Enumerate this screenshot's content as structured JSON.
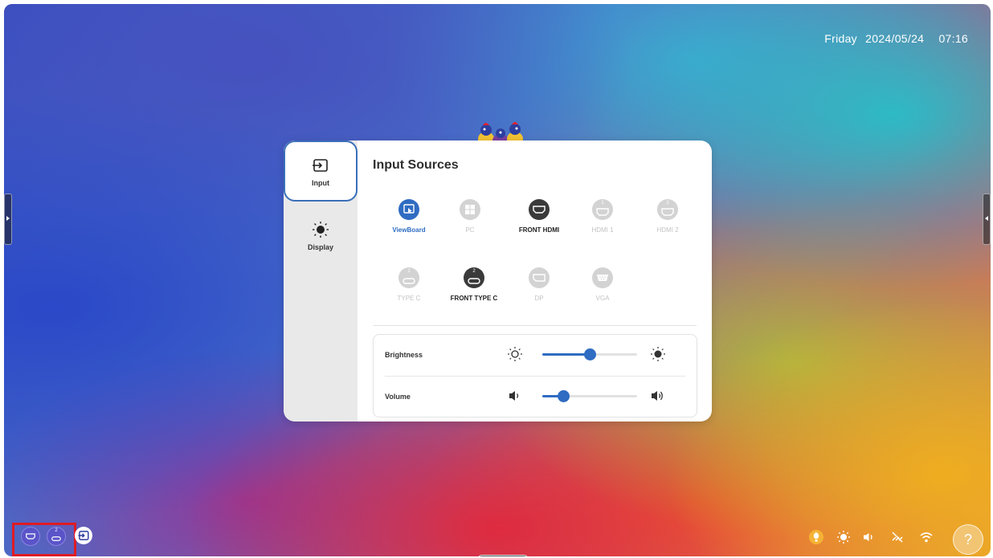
{
  "status_bar": {
    "day": "Friday",
    "date": "2024/05/24",
    "time": "07:16"
  },
  "panel": {
    "title": "Input Sources",
    "tabs": [
      {
        "label": "Input",
        "icon": "input-icon",
        "active": true
      },
      {
        "label": "Display",
        "icon": "brightness-icon",
        "active": false
      }
    ],
    "sources_row1": [
      {
        "label": "ViewBoard",
        "icon": "viewboard-icon",
        "state": "selected"
      },
      {
        "label": "PC",
        "icon": "windows-icon",
        "state": "unavailable"
      },
      {
        "label": "FRONT HDMI",
        "icon": "hdmi-icon",
        "state": "available"
      },
      {
        "label": "HDMI 1",
        "icon": "hdmi-icon",
        "num": "1",
        "state": "unavailable"
      },
      {
        "label": "HDMI 2",
        "icon": "hdmi-icon",
        "num": "2",
        "state": "unavailable"
      }
    ],
    "sources_row2": [
      {
        "label": "TYPE C",
        "icon": "usb-c-icon",
        "num": "1",
        "state": "unavailable"
      },
      {
        "label": "FRONT TYPE C",
        "icon": "usb-c-icon",
        "num": "2",
        "state": "available"
      },
      {
        "label": "DP",
        "icon": "displayport-icon",
        "state": "unavailable"
      },
      {
        "label": "VGA",
        "icon": "vga-icon",
        "state": "unavailable"
      }
    ],
    "controls": {
      "brightness": {
        "label": "Brightness",
        "value_fraction": 0.5
      },
      "volume": {
        "label": "Volume",
        "value_fraction": 0.22
      }
    }
  },
  "taskbar": {
    "left": [
      {
        "icon": "hdmi-icon"
      },
      {
        "icon": "usb-c-icon",
        "num": "2"
      },
      {
        "icon": "input-icon"
      }
    ],
    "tray": [
      "eye-care-icon",
      "brightness-icon",
      "volume-icon",
      "network-disconnected-icon",
      "wifi-icon"
    ],
    "help_label": "?"
  },
  "colors": {
    "accent": "#2f6cc2",
    "highlight": "#e01b24"
  }
}
